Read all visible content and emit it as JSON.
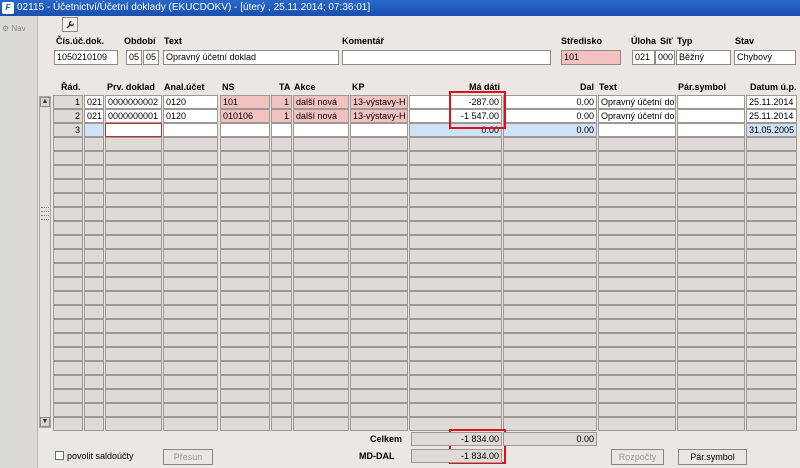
{
  "window": {
    "title": "02115 - Účetnictví/Účetní doklady (EKUCDOKV) - [úterý , 25.11.2014; 07:36:01]",
    "logo": "F"
  },
  "sidebar": {
    "nav_label": "Nav"
  },
  "toolbar": {
    "icon": "wrench-icon"
  },
  "header": {
    "labels": {
      "cis": "Čís.úč.dok.",
      "obdobi": "Období",
      "text": "Text",
      "komentar": "Komentář",
      "stredisko": "Středisko",
      "uloha": "Úloha",
      "sit": "Síť",
      "typ": "Typ",
      "stav": "Stav"
    },
    "values": {
      "cis": "1050210109",
      "obdobi_1": "05",
      "obdobi_2": "05",
      "text": "Opravný účetní doklad",
      "komentar": "",
      "stredisko": "101",
      "uloha": "021",
      "sit": "000",
      "typ": "Běžný",
      "stav": "Chybový"
    }
  },
  "columns": {
    "rad": "Řád.",
    "prv": "Prv. doklad",
    "anal": "Anal.účet",
    "ns": "NS",
    "ta": "TA",
    "akce": "Akce",
    "kp": "KP",
    "ma_dati": "Má dáti",
    "dal": "Dal",
    "text": "Text",
    "par": "Pár.symbol",
    "datum": "Datum ú.p."
  },
  "rows": [
    {
      "rad": "1",
      "c2": "021",
      "prv": "0000000002",
      "anal": "0120",
      "ns": "101",
      "ta": "1",
      "akce": "další nová",
      "kp": "13-výstavy-H",
      "ma_dati": "-287.00",
      "dal": "0.00",
      "text": "Opravný účetní dokl",
      "par": "",
      "datum": "25.11.2014"
    },
    {
      "rad": "2",
      "c2": "021",
      "prv": "0000000001",
      "anal": "0120",
      "ns": "010106",
      "ta": "1",
      "akce": "další nová",
      "kp": "13-výstavy-H",
      "ma_dati": "-1 547.00",
      "dal": "0.00",
      "text": "Opravný účetní dokl",
      "par": "",
      "datum": "25.11.2014"
    },
    {
      "rad": "3",
      "c2": "",
      "prv": "",
      "anal": "",
      "ns": "",
      "ta": "",
      "akce": "",
      "kp": "",
      "ma_dati": "0.00",
      "dal": "0.00",
      "text": "",
      "par": "",
      "datum": "31.05.2005"
    }
  ],
  "footer": {
    "celkem_label": "Celkem",
    "celkem_md": "-1 834.00",
    "celkem_dal": "0.00",
    "mddal_label": "MD-DAL",
    "mddal_value": "-1 834.00",
    "saldo_label": "povolit saldoúčty",
    "presun": "Přesun",
    "rozpocty": "Rozpočty",
    "parsymbol": "Pár.symbol"
  },
  "colors": {
    "highlight": "#e0101a",
    "pink": "#f4c1c1",
    "selected_row": "#cfe2f7",
    "title_bar": "#1a4fae"
  }
}
